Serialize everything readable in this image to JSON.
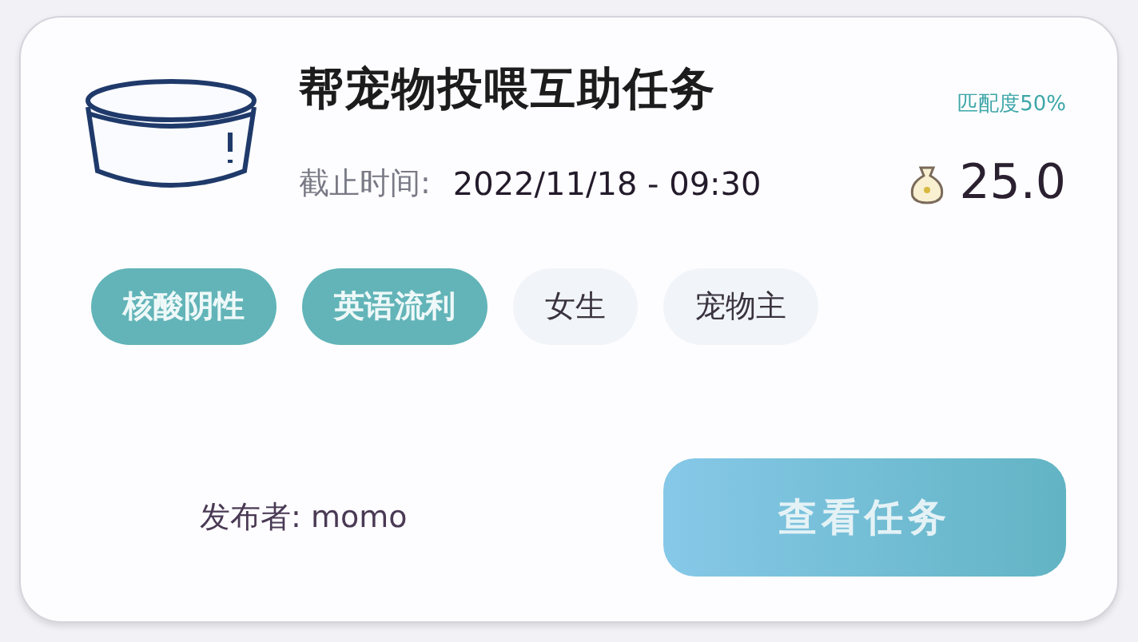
{
  "task": {
    "title": "帮宠物投喂互助任务",
    "match": "匹配度50%",
    "deadline_label": "截止时间:",
    "deadline": "2022/11/18 - 09:30",
    "reward": "25.0"
  },
  "tags": [
    {
      "label": "核酸阴性",
      "selected": true
    },
    {
      "label": "英语流利",
      "selected": true
    },
    {
      "label": "女生",
      "selected": false
    },
    {
      "label": "宠物主",
      "selected": false
    }
  ],
  "publisher": {
    "label": "发布者:",
    "name": "momo"
  },
  "button": "查看任务"
}
